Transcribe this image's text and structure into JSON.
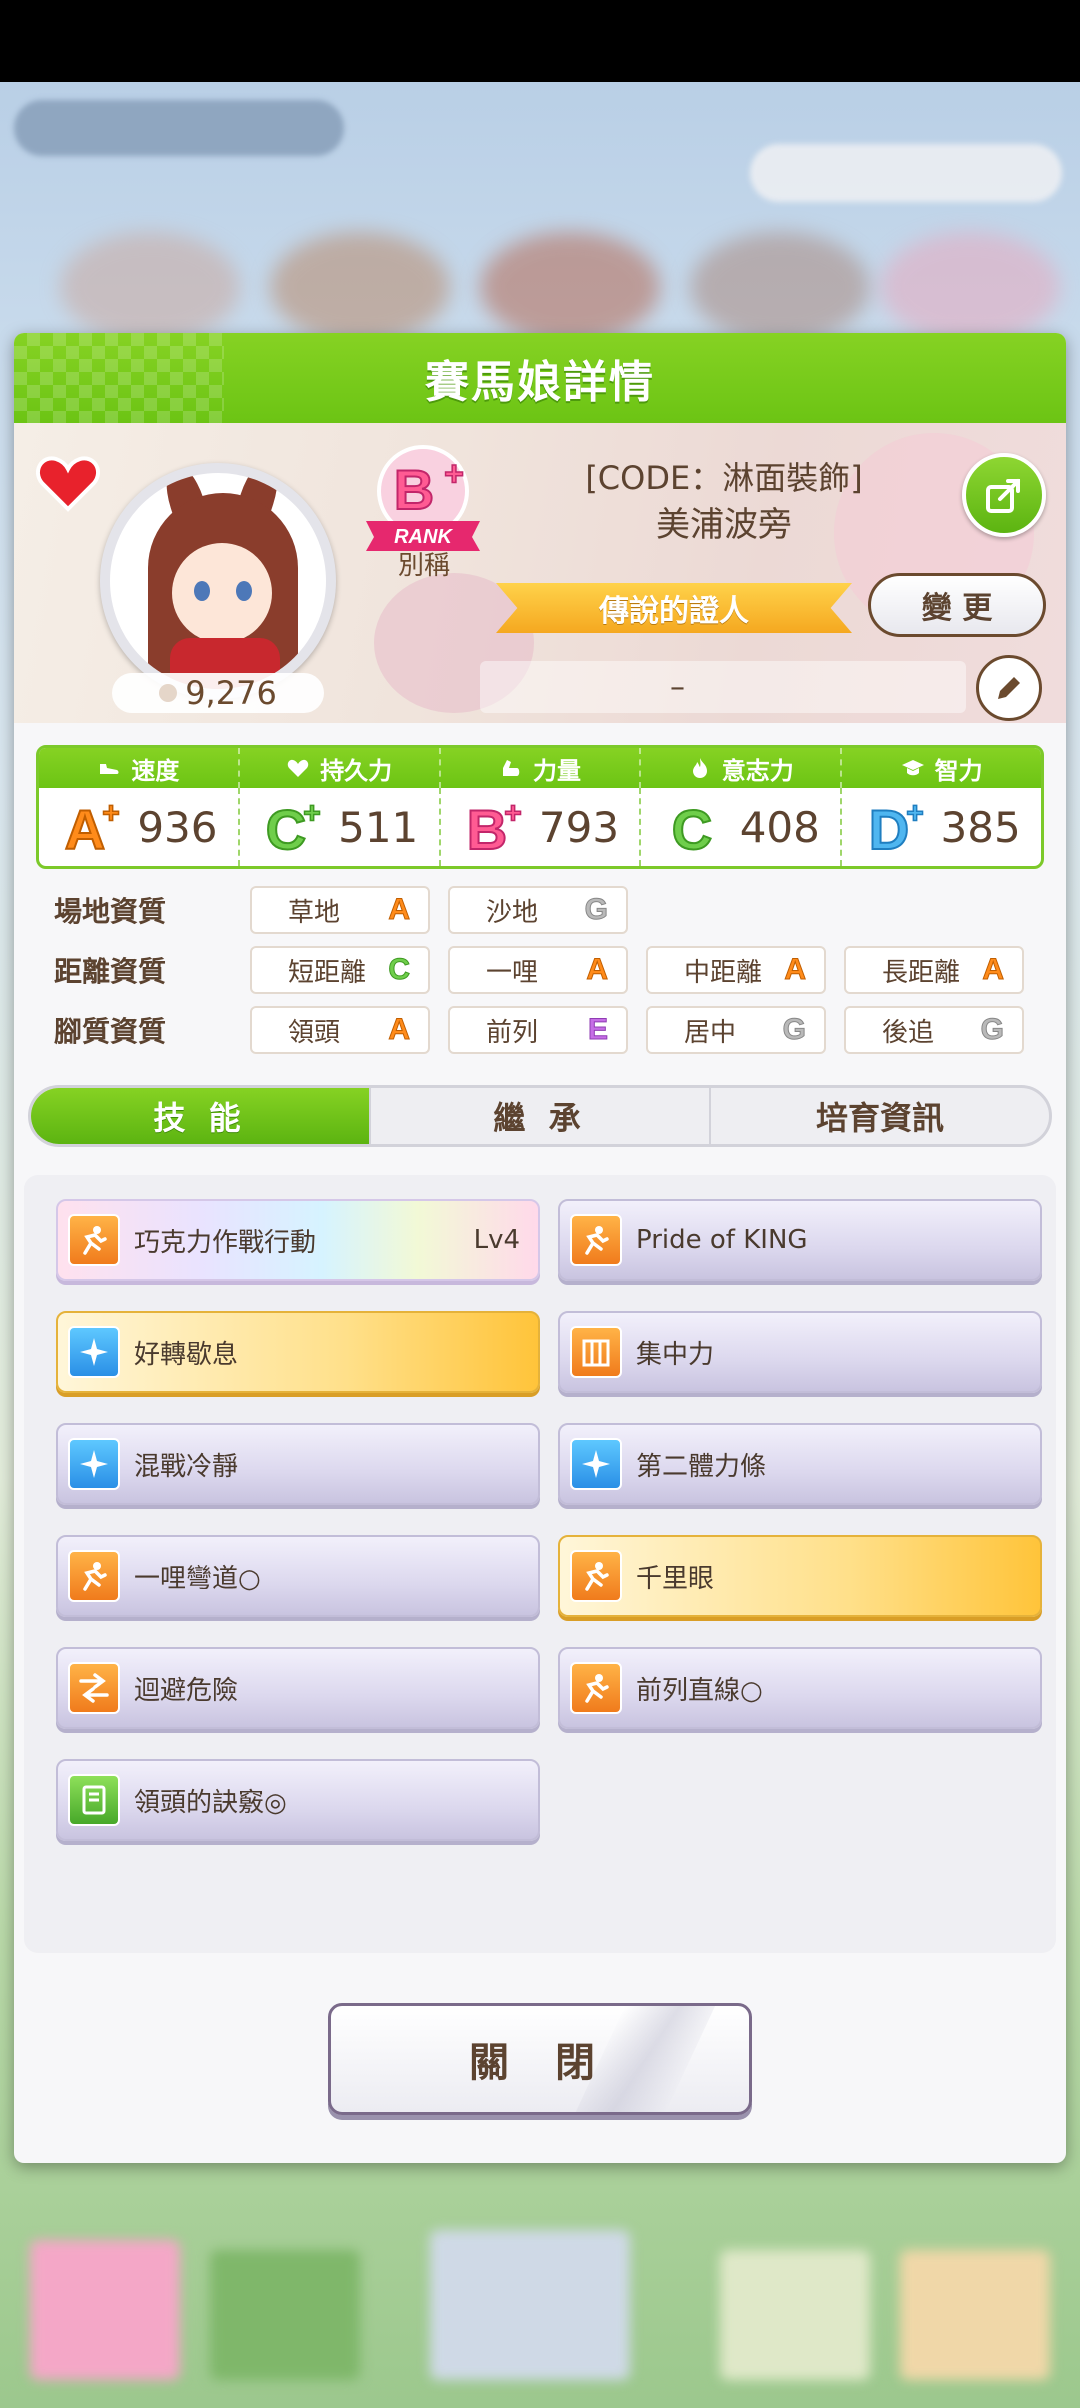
{
  "dialog": {
    "title": "賽馬娘詳情"
  },
  "character": {
    "rank_sub": "別稱",
    "title_code": "[CODE：淋面裝飾]",
    "name": "美浦波旁",
    "epithet": "傳說的證人",
    "fans": "9,276",
    "change_label": "變 更",
    "memo": "–"
  },
  "stats": [
    {
      "label": "速度",
      "grade": "A+",
      "value": "936",
      "icon": "shoe-icon"
    },
    {
      "label": "持久力",
      "grade": "C+",
      "value": "511",
      "icon": "heart-icon"
    },
    {
      "label": "力量",
      "grade": "B+",
      "value": "793",
      "icon": "arm-icon"
    },
    {
      "label": "意志力",
      "grade": "C",
      "value": "408",
      "icon": "flame-icon"
    },
    {
      "label": "智力",
      "grade": "D+",
      "value": "385",
      "icon": "graduation-cap-icon"
    }
  ],
  "aptitude": {
    "track": {
      "label": "場地資質",
      "items": [
        {
          "name": "草地",
          "grade": "A"
        },
        {
          "name": "沙地",
          "grade": "G"
        }
      ]
    },
    "distance": {
      "label": "距離資質",
      "items": [
        {
          "name": "短距離",
          "grade": "C"
        },
        {
          "name": "一哩",
          "grade": "A"
        },
        {
          "name": "中距離",
          "grade": "A"
        },
        {
          "name": "長距離",
          "grade": "A"
        }
      ]
    },
    "style": {
      "label": "腳質資質",
      "items": [
        {
          "name": "領頭",
          "grade": "A"
        },
        {
          "name": "前列",
          "grade": "E"
        },
        {
          "name": "居中",
          "grade": "G"
        },
        {
          "name": "後追",
          "grade": "G"
        }
      ]
    }
  },
  "tabs": [
    {
      "label": "技 能",
      "active": true
    },
    {
      "label": "繼 承",
      "active": false
    },
    {
      "label": "培育資訊",
      "active": false
    }
  ],
  "skills": [
    {
      "name": "巧克力作戰行動",
      "level": "Lv4",
      "style": "rainbow",
      "icon": "runner-icon",
      "icon_color": "orange"
    },
    {
      "name": "Pride of KING",
      "level": "",
      "style": "normal",
      "icon": "runner-icon",
      "icon_color": "orange"
    },
    {
      "name": "好轉歇息",
      "level": "",
      "style": "gold",
      "icon": "sparkle-icon",
      "icon_color": "blue"
    },
    {
      "name": "集中力",
      "level": "",
      "style": "normal",
      "icon": "gate-icon",
      "icon_color": "orange"
    },
    {
      "name": "混戰冷靜",
      "level": "",
      "style": "normal",
      "icon": "sparkle-icon",
      "icon_color": "blue"
    },
    {
      "name": "第二體力條",
      "level": "",
      "style": "normal",
      "icon": "sparkle-icon",
      "icon_color": "blue"
    },
    {
      "name": "一哩彎道○",
      "level": "",
      "style": "normal",
      "icon": "runner-icon",
      "icon_color": "orange"
    },
    {
      "name": "千里眼",
      "level": "",
      "style": "gold",
      "icon": "runner-icon",
      "icon_color": "orange"
    },
    {
      "name": "迴避危險",
      "level": "",
      "style": "normal",
      "icon": "arrow-icon",
      "icon_color": "orange"
    },
    {
      "name": "前列直線○",
      "level": "",
      "style": "normal",
      "icon": "runner-icon",
      "icon_color": "orange"
    },
    {
      "name": "領頭的訣竅◎",
      "level": "",
      "style": "normal",
      "icon": "book-icon",
      "icon_color": "green"
    }
  ],
  "close_label": "關 閉"
}
